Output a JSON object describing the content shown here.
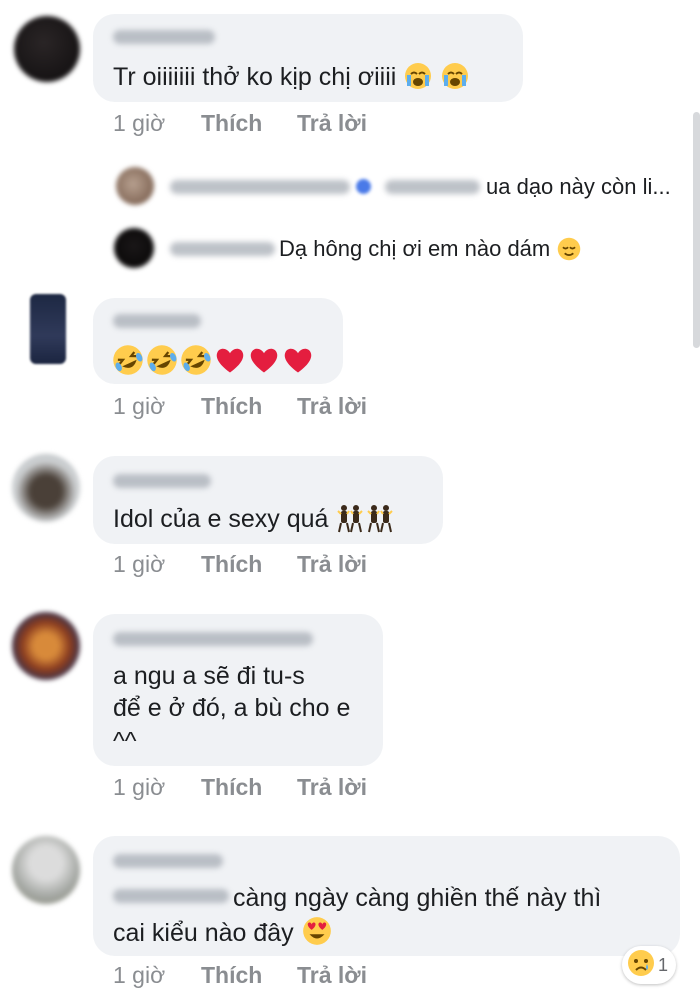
{
  "comments": [
    {
      "text_lines": [
        "Tr oiiiiiii thở ko kịp chị ơiiii"
      ],
      "time": "1 giờ",
      "like": "Thích",
      "reply": "Trả lời",
      "trailing_emoji": [
        "crying-face",
        "crying-face"
      ]
    },
    {
      "text_lines": [
        ""
      ],
      "time": "1 giờ",
      "like": "Thích",
      "reply": "Trả lời",
      "trailing_emoji": [
        "rofl",
        "rofl",
        "rofl",
        "heart",
        "heart",
        "heart"
      ]
    },
    {
      "text_lines": [
        "Idol của e sexy quá"
      ],
      "time": "1 giờ",
      "like": "Thích",
      "reply": "Trả lời",
      "trailing_emoji": [
        "dancers",
        "dancers"
      ]
    },
    {
      "text_lines": [
        "a ngu a sẽ đi tu-s",
        "để e ở đó, a bù cho e",
        "^^"
      ],
      "time": "1 giờ",
      "like": "Thích",
      "reply": "Trả lời"
    },
    {
      "text_lines": [
        "càng ngày càng ghiền thế này thì",
        "cai kiểu nào đây"
      ],
      "time": "1 giờ",
      "like": "Thích",
      "reply": "Trả lời",
      "trailing_emoji": [
        "heart-eyes"
      ],
      "reaction": {
        "icon": "sad-face",
        "count": "1"
      }
    }
  ],
  "replies": [
    {
      "text": "ua dạo này còn li..."
    },
    {
      "text": "Dạ hông chị ơi em nào dám",
      "trailing_emoji": [
        "relieved-face"
      ]
    }
  ],
  "colors": {
    "bubble": "#f0f2f5",
    "meta": "#8a8d91",
    "heart": "#e41e3f",
    "emoji_yellow": "#ffcc4d"
  }
}
